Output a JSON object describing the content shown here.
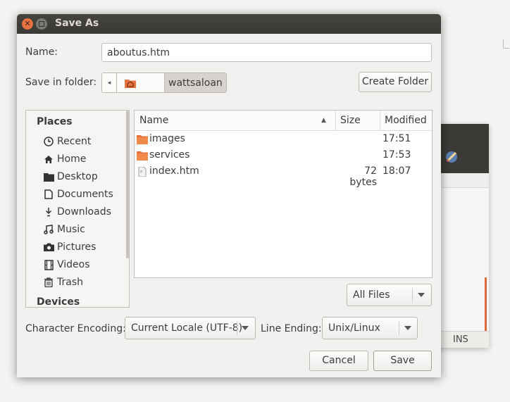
{
  "dialog": {
    "title": "Save As",
    "name_label": "Name:",
    "name_value": "aboutus.htm",
    "folder_label": "Save in folder:",
    "folder_current": "wattsaloan",
    "create_folder_label": "Create Folder"
  },
  "places": {
    "heading": "Places",
    "items": [
      {
        "label": "Recent",
        "icon": "clock-icon"
      },
      {
        "label": "Home",
        "icon": "home-icon"
      },
      {
        "label": "Desktop",
        "icon": "desktop-folder-icon"
      },
      {
        "label": "Documents",
        "icon": "document-icon"
      },
      {
        "label": "Downloads",
        "icon": "download-icon"
      },
      {
        "label": "Music",
        "icon": "music-icon"
      },
      {
        "label": "Pictures",
        "icon": "camera-icon"
      },
      {
        "label": "Videos",
        "icon": "film-icon"
      },
      {
        "label": "Trash",
        "icon": "trash-icon"
      }
    ],
    "devices_heading": "Devices"
  },
  "files": {
    "columns": {
      "name": "Name",
      "size": "Size",
      "modified": "Modified"
    },
    "rows": [
      {
        "name": "images",
        "size": "",
        "modified": "17:51",
        "type": "folder"
      },
      {
        "name": "services",
        "size": "",
        "modified": "17:53",
        "type": "folder"
      },
      {
        "name": "index.htm",
        "size": "72 bytes",
        "modified": "18:07",
        "type": "file"
      }
    ]
  },
  "filter": {
    "value": "All Files"
  },
  "encoding": {
    "label": "Character Encoding:",
    "value": "Current Locale (UTF-8)"
  },
  "line_ending": {
    "label": "Line Ending:",
    "value": "Unix/Linux"
  },
  "actions": {
    "cancel": "Cancel",
    "save": "Save"
  },
  "background_window": {
    "status": "INS"
  },
  "colors": {
    "accent": "#e9703f",
    "titlebar": "#3c3b37",
    "folder": "#e8723f"
  }
}
